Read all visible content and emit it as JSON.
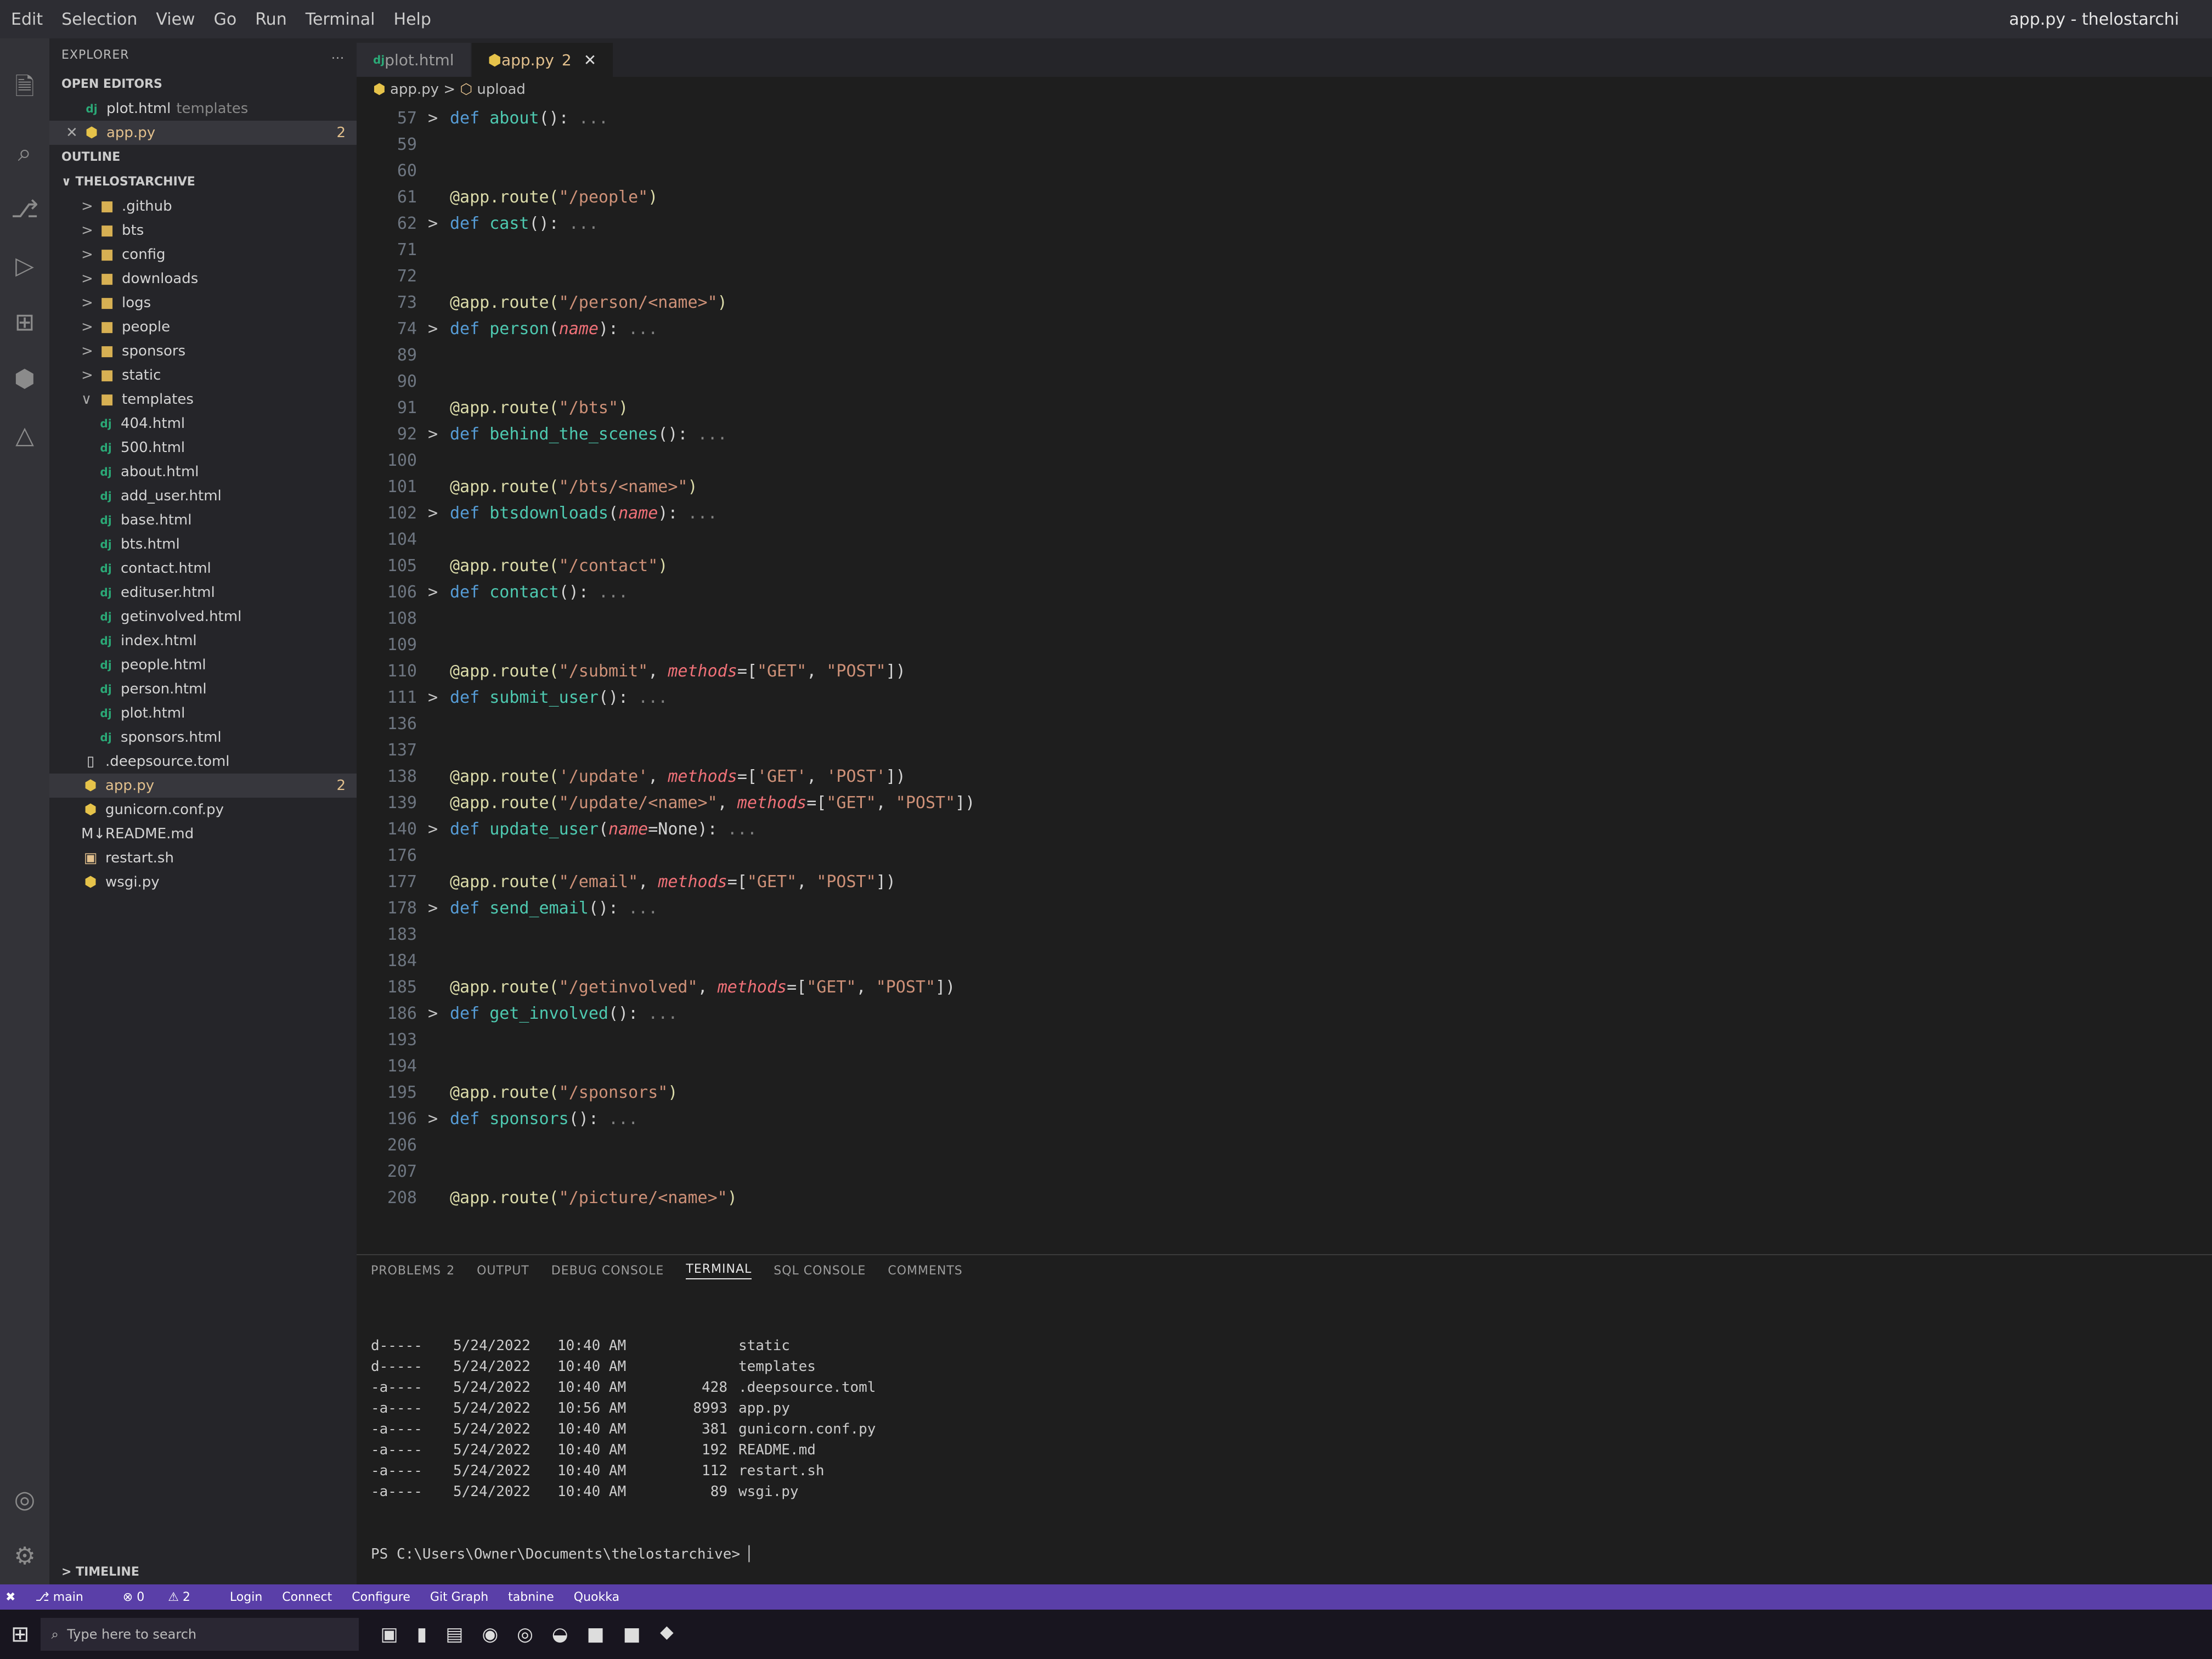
{
  "window": {
    "title": "app.py - thelostarchi",
    "menu": [
      "Edit",
      "Selection",
      "View",
      "Go",
      "Run",
      "Terminal",
      "Help"
    ]
  },
  "sidebar": {
    "explorer_label": "EXPLORER",
    "more_label": "...",
    "open_editors_label": "OPEN EDITORS",
    "open_editors": [
      {
        "icon": "dj",
        "name": "plot.html",
        "path": "templates",
        "badge": "",
        "modified": false
      },
      {
        "icon": "py",
        "name": "app.py",
        "path": "",
        "badge": "2",
        "modified": true
      }
    ],
    "outline_label": "OUTLINE",
    "project_label": "THELOSTARCHIVE",
    "folders": [
      ".github",
      "bts",
      "config",
      "downloads",
      "logs",
      "people",
      "sponsors",
      "static"
    ],
    "templates_label": "templates",
    "templates": [
      "404.html",
      "500.html",
      "about.html",
      "add_user.html",
      "base.html",
      "bts.html",
      "contact.html",
      "edituser.html",
      "getinvolved.html",
      "index.html",
      "people.html",
      "person.html",
      "plot.html",
      "sponsors.html"
    ],
    "root_files": [
      {
        "icon": "file",
        "name": ".deepsource.toml",
        "badge": ""
      },
      {
        "icon": "py",
        "name": "app.py",
        "badge": "2"
      },
      {
        "icon": "py",
        "name": "gunicorn.conf.py",
        "badge": ""
      },
      {
        "icon": "md",
        "name": "README.md",
        "badge": ""
      },
      {
        "icon": "sh",
        "name": "restart.sh",
        "badge": ""
      },
      {
        "icon": "py",
        "name": "wsgi.py",
        "badge": ""
      }
    ],
    "timeline_label": "TIMELINE"
  },
  "editor": {
    "tabs": [
      {
        "name": "plot.html",
        "icon": "dj",
        "active": false,
        "count": ""
      },
      {
        "name": "app.py",
        "icon": "py",
        "active": true,
        "count": "2"
      }
    ],
    "breadcrumb": [
      "app.py",
      "upload"
    ],
    "lines": [
      {
        "n": "57",
        "fold": ">",
        "segs": [
          [
            "kw",
            "def "
          ],
          [
            "fn",
            "about"
          ],
          [
            "",
            "():"
          ],
          [
            "ell",
            " ..."
          ]
        ]
      },
      {
        "n": "59",
        "fold": "",
        "segs": []
      },
      {
        "n": "60",
        "fold": "",
        "segs": []
      },
      {
        "n": "61",
        "fold": "",
        "segs": [
          [
            "dec",
            "@app.route("
          ],
          [
            "str",
            "\"/people\""
          ],
          [
            "dec",
            ")"
          ]
        ]
      },
      {
        "n": "62",
        "fold": ">",
        "segs": [
          [
            "kw",
            "def "
          ],
          [
            "fn",
            "cast"
          ],
          [
            "",
            "():"
          ],
          [
            "ell",
            " ..."
          ]
        ]
      },
      {
        "n": "71",
        "fold": "",
        "segs": []
      },
      {
        "n": "72",
        "fold": "",
        "segs": []
      },
      {
        "n": "73",
        "fold": "",
        "segs": [
          [
            "dec",
            "@app.route("
          ],
          [
            "str",
            "\"/person/<name>\""
          ],
          [
            "dec",
            ")"
          ]
        ]
      },
      {
        "n": "74",
        "fold": ">",
        "segs": [
          [
            "kw",
            "def "
          ],
          [
            "fn",
            "person"
          ],
          [
            "",
            "("
          ],
          [
            "par",
            "name"
          ],
          [
            "",
            "):"
          ],
          [
            "ell",
            " ..."
          ]
        ]
      },
      {
        "n": "89",
        "fold": "",
        "segs": []
      },
      {
        "n": "90",
        "fold": "",
        "segs": []
      },
      {
        "n": "91",
        "fold": "",
        "segs": [
          [
            "dec",
            "@app.route("
          ],
          [
            "str",
            "\"/bts\""
          ],
          [
            "dec",
            ")"
          ]
        ]
      },
      {
        "n": "92",
        "fold": ">",
        "segs": [
          [
            "kw",
            "def "
          ],
          [
            "fn",
            "behind_the_scenes"
          ],
          [
            "",
            "():"
          ],
          [
            "ell",
            " ..."
          ]
        ]
      },
      {
        "n": "100",
        "fold": "",
        "segs": []
      },
      {
        "n": "101",
        "fold": "",
        "segs": [
          [
            "dec",
            "@app.route("
          ],
          [
            "str",
            "\"/bts/<name>\""
          ],
          [
            "dec",
            ")"
          ]
        ]
      },
      {
        "n": "102",
        "fold": ">",
        "segs": [
          [
            "kw",
            "def "
          ],
          [
            "fn",
            "btsdownloads"
          ],
          [
            "",
            "("
          ],
          [
            "par",
            "name"
          ],
          [
            "",
            "):"
          ],
          [
            "ell",
            " ..."
          ]
        ]
      },
      {
        "n": "104",
        "fold": "",
        "segs": []
      },
      {
        "n": "105",
        "fold": "",
        "segs": [
          [
            "dec",
            "@app.route("
          ],
          [
            "str",
            "\"/contact\""
          ],
          [
            "dec",
            ")"
          ]
        ]
      },
      {
        "n": "106",
        "fold": ">",
        "segs": [
          [
            "kw",
            "def "
          ],
          [
            "fn",
            "contact"
          ],
          [
            "",
            "():"
          ],
          [
            "ell",
            " ..."
          ]
        ]
      },
      {
        "n": "108",
        "fold": "",
        "segs": []
      },
      {
        "n": "109",
        "fold": "",
        "segs": []
      },
      {
        "n": "110",
        "fold": "",
        "segs": [
          [
            "dec",
            "@app.route("
          ],
          [
            "str",
            "\"/submit\""
          ],
          [
            "",
            ", "
          ],
          [
            "par",
            "methods"
          ],
          [
            "",
            "=["
          ],
          [
            "str",
            "\"GET\""
          ],
          [
            "",
            ", "
          ],
          [
            "str",
            "\"POST\""
          ],
          [
            "",
            "])"
          ]
        ]
      },
      {
        "n": "111",
        "fold": ">",
        "segs": [
          [
            "kw",
            "def "
          ],
          [
            "fn",
            "submit_user"
          ],
          [
            "",
            "():"
          ],
          [
            "ell",
            " ..."
          ]
        ]
      },
      {
        "n": "136",
        "fold": "",
        "segs": []
      },
      {
        "n": "137",
        "fold": "",
        "segs": []
      },
      {
        "n": "138",
        "fold": "",
        "segs": [
          [
            "dec",
            "@app.route("
          ],
          [
            "str",
            "'/update'"
          ],
          [
            "",
            ", "
          ],
          [
            "par",
            "methods"
          ],
          [
            "",
            "=["
          ],
          [
            "str",
            "'GET'"
          ],
          [
            "",
            ", "
          ],
          [
            "str",
            "'POST'"
          ],
          [
            "",
            "])"
          ]
        ]
      },
      {
        "n": "139",
        "fold": "",
        "segs": [
          [
            "dec",
            "@app.route("
          ],
          [
            "str",
            "\"/update/<name>\""
          ],
          [
            "",
            ", "
          ],
          [
            "par",
            "methods"
          ],
          [
            "",
            "=["
          ],
          [
            "str",
            "\"GET\""
          ],
          [
            "",
            ", "
          ],
          [
            "str",
            "\"POST\""
          ],
          [
            "",
            "])"
          ]
        ]
      },
      {
        "n": "140",
        "fold": ">",
        "segs": [
          [
            "kw",
            "def "
          ],
          [
            "fn",
            "update_user"
          ],
          [
            "",
            "("
          ],
          [
            "par",
            "name"
          ],
          [
            "",
            "=None):"
          ],
          [
            "ell",
            " ..."
          ]
        ]
      },
      {
        "n": "176",
        "fold": "",
        "segs": []
      },
      {
        "n": "177",
        "fold": "",
        "segs": [
          [
            "dec",
            "@app.route("
          ],
          [
            "str",
            "\"/email\""
          ],
          [
            "",
            ", "
          ],
          [
            "par",
            "methods"
          ],
          [
            "",
            "=["
          ],
          [
            "str",
            "\"GET\""
          ],
          [
            "",
            ", "
          ],
          [
            "str",
            "\"POST\""
          ],
          [
            "",
            "])"
          ]
        ]
      },
      {
        "n": "178",
        "fold": ">",
        "segs": [
          [
            "kw",
            "def "
          ],
          [
            "fn",
            "send_email"
          ],
          [
            "",
            "():"
          ],
          [
            "ell",
            " ..."
          ]
        ]
      },
      {
        "n": "183",
        "fold": "",
        "segs": []
      },
      {
        "n": "184",
        "fold": "",
        "segs": []
      },
      {
        "n": "185",
        "fold": "",
        "segs": [
          [
            "dec",
            "@app.route("
          ],
          [
            "str",
            "\"/getinvolved\""
          ],
          [
            "",
            ", "
          ],
          [
            "par",
            "methods"
          ],
          [
            "",
            "=["
          ],
          [
            "str",
            "\"GET\""
          ],
          [
            "",
            ", "
          ],
          [
            "str",
            "\"POST\""
          ],
          [
            "",
            "])"
          ]
        ]
      },
      {
        "n": "186",
        "fold": ">",
        "segs": [
          [
            "kw",
            "def "
          ],
          [
            "fn",
            "get_involved"
          ],
          [
            "",
            "():"
          ],
          [
            "ell",
            " ..."
          ]
        ]
      },
      {
        "n": "193",
        "fold": "",
        "segs": []
      },
      {
        "n": "194",
        "fold": "",
        "segs": []
      },
      {
        "n": "195",
        "fold": "",
        "segs": [
          [
            "dec",
            "@app.route("
          ],
          [
            "str",
            "\"/sponsors\""
          ],
          [
            "dec",
            ")"
          ]
        ]
      },
      {
        "n": "196",
        "fold": ">",
        "segs": [
          [
            "kw",
            "def "
          ],
          [
            "fn",
            "sponsors"
          ],
          [
            "",
            "():"
          ],
          [
            "ell",
            " ..."
          ]
        ]
      },
      {
        "n": "206",
        "fold": "",
        "segs": []
      },
      {
        "n": "207",
        "fold": "",
        "segs": []
      },
      {
        "n": "208",
        "fold": "",
        "segs": [
          [
            "dec",
            "@app.route("
          ],
          [
            "str",
            "\"/picture/<name>\""
          ],
          [
            "dec",
            ")"
          ]
        ]
      }
    ]
  },
  "panel": {
    "tabs": [
      {
        "label": "PROBLEMS",
        "count": "2",
        "active": false
      },
      {
        "label": "OUTPUT",
        "count": "",
        "active": false
      },
      {
        "label": "DEBUG CONSOLE",
        "count": "",
        "active": false
      },
      {
        "label": "TERMINAL",
        "count": "",
        "active": true
      },
      {
        "label": "SQL CONSOLE",
        "count": "",
        "active": false
      },
      {
        "label": "COMMENTS",
        "count": "",
        "active": false
      }
    ],
    "listing": [
      {
        "mode": "d-----",
        "date": "5/24/2022",
        "time": "10:40 AM",
        "length": "",
        "name": "static"
      },
      {
        "mode": "d-----",
        "date": "5/24/2022",
        "time": "10:40 AM",
        "length": "",
        "name": "templates"
      },
      {
        "mode": "-a----",
        "date": "5/24/2022",
        "time": "10:40 AM",
        "length": "428",
        "name": ".deepsource.toml"
      },
      {
        "mode": "-a----",
        "date": "5/24/2022",
        "time": "10:56 AM",
        "length": "8993",
        "name": "app.py"
      },
      {
        "mode": "-a----",
        "date": "5/24/2022",
        "time": "10:40 AM",
        "length": "381",
        "name": "gunicorn.conf.py"
      },
      {
        "mode": "-a----",
        "date": "5/24/2022",
        "time": "10:40 AM",
        "length": "192",
        "name": "README.md"
      },
      {
        "mode": "-a----",
        "date": "5/24/2022",
        "time": "10:40 AM",
        "length": "112",
        "name": "restart.sh"
      },
      {
        "mode": "-a----",
        "date": "5/24/2022",
        "time": "10:40 AM",
        "length": "89",
        "name": "wsgi.py"
      }
    ],
    "prompt": "PS C:\\Users\\Owner\\Documents\\thelostarchive> "
  },
  "statusbar": {
    "branch": "main",
    "errors": "0",
    "warnings": "2",
    "items": [
      "Login",
      "Connect",
      "Configure",
      "Git Graph",
      "tabnine",
      "Quokka"
    ]
  },
  "taskbar": {
    "search_placeholder": "Type here to search"
  },
  "colors": {
    "statusbar": "#5a3fa8",
    "editor_bg": "#1e1e1e",
    "sidebar_bg": "#252529",
    "decorator": "#dcdcaa",
    "keyword": "#569cd6",
    "function": "#4ec9b0",
    "string": "#ce9178",
    "param": "#f07178"
  }
}
